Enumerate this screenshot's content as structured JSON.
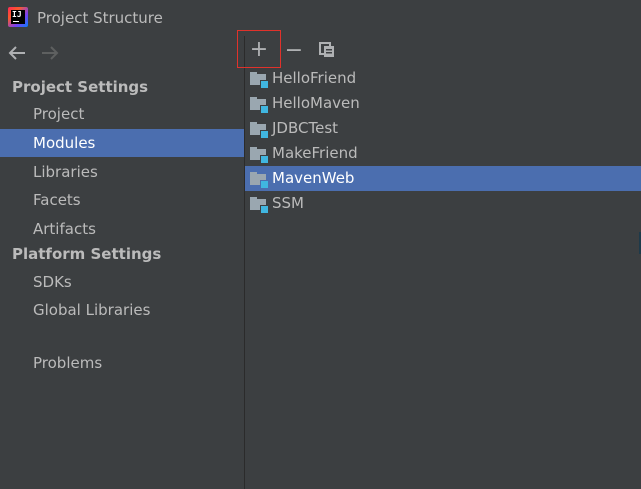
{
  "window": {
    "title": "Project Structure",
    "app_icon": "intellij-idea-icon"
  },
  "navigation": {
    "back_icon": "arrow-left-icon",
    "forward_icon": "arrow-right-icon"
  },
  "sidebar": {
    "project_settings_header": "Project Settings",
    "project_settings_items": [
      {
        "label": "Project",
        "selected": false
      },
      {
        "label": "Modules",
        "selected": true
      },
      {
        "label": "Libraries",
        "selected": false
      },
      {
        "label": "Facets",
        "selected": false
      },
      {
        "label": "Artifacts",
        "selected": false
      }
    ],
    "platform_settings_header": "Platform Settings",
    "platform_settings_items": [
      {
        "label": "SDKs",
        "selected": false
      },
      {
        "label": "Global Libraries",
        "selected": false
      }
    ],
    "problems_label": "Problems"
  },
  "toolbar": {
    "add_symbol": "+",
    "remove_symbol": "−",
    "copy_icon": "copy-icon"
  },
  "modules": [
    {
      "label": "HelloFriend",
      "selected": false
    },
    {
      "label": "HelloMaven",
      "selected": false
    },
    {
      "label": "JDBCTest",
      "selected": false
    },
    {
      "label": "MakeFriend",
      "selected": false
    },
    {
      "label": "MavenWeb",
      "selected": true
    },
    {
      "label": "SSM",
      "selected": false
    }
  ],
  "colors": {
    "background": "#3c3f41",
    "selection": "#4b6eaf",
    "highlight_border": "#e0322b",
    "module_badge": "#40b6e0"
  }
}
